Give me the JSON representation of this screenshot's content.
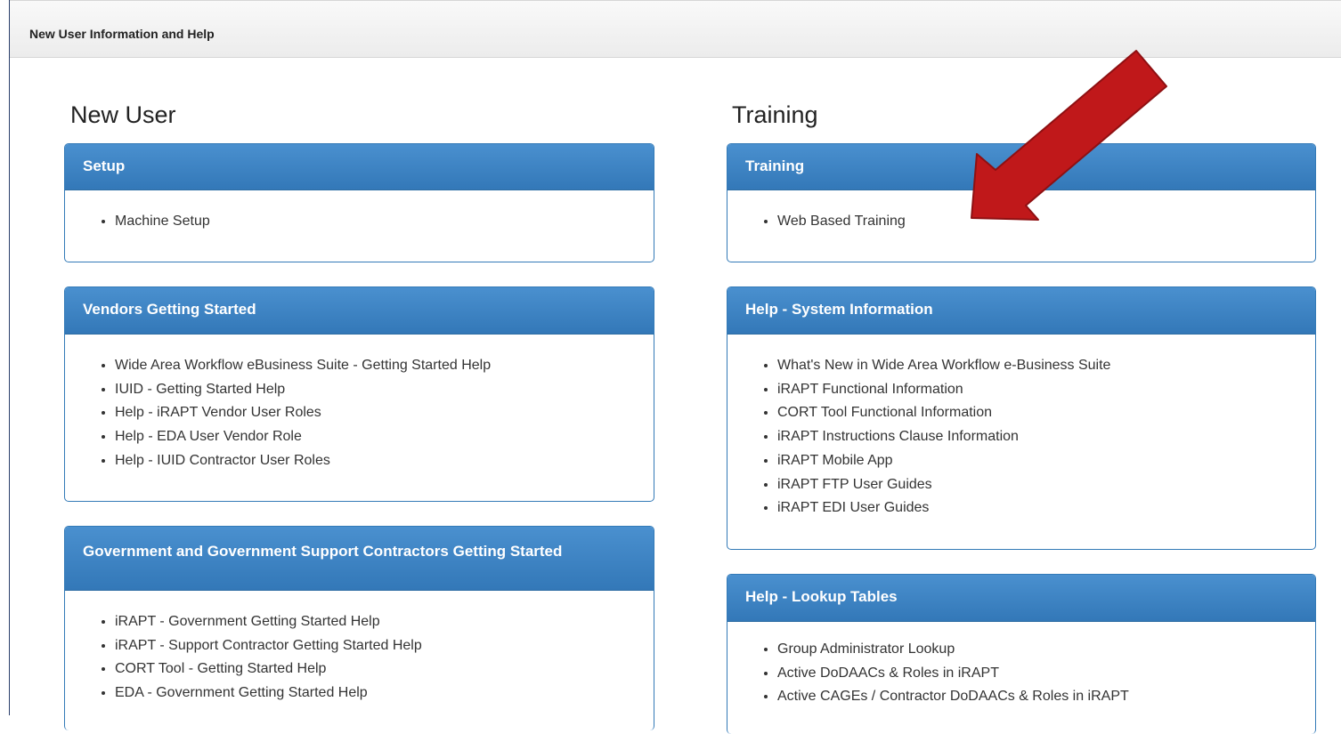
{
  "header": {
    "title": "New User Information and Help"
  },
  "columns": {
    "left_title": "New User",
    "right_title": "Training"
  },
  "panels": {
    "setup": {
      "title": "Setup",
      "items": [
        "Machine Setup"
      ]
    },
    "vendors": {
      "title": "Vendors Getting Started",
      "items": [
        "Wide Area Workflow eBusiness Suite - Getting Started Help",
        "IUID - Getting Started Help",
        "Help - iRAPT Vendor User Roles",
        "Help - EDA User Vendor Role",
        "Help - IUID Contractor User Roles"
      ]
    },
    "government": {
      "title": "Government and Government Support Contractors Getting Started",
      "items": [
        "iRAPT - Government Getting Started Help",
        "iRAPT - Support Contractor Getting Started Help",
        "CORT Tool - Getting Started Help",
        "EDA - Government Getting Started Help"
      ]
    },
    "training": {
      "title": "Training",
      "items": [
        "Web Based Training"
      ]
    },
    "system_info": {
      "title": "Help - System Information",
      "items": [
        "What's New in Wide Area Workflow e-Business Suite",
        "iRAPT Functional Information",
        "CORT Tool Functional Information",
        "iRAPT Instructions Clause Information",
        "iRAPT Mobile App",
        "iRAPT FTP User Guides",
        "iRAPT EDI User Guides"
      ]
    },
    "lookup": {
      "title": "Help - Lookup Tables",
      "items": [
        "Group Administrator Lookup",
        "Active DoDAACs & Roles in iRAPT",
        "Active CAGEs / Contractor DoDAACs & Roles in iRAPT"
      ]
    }
  },
  "colors": {
    "panel_header": "#3a80c0",
    "panel_border": "#337ab7",
    "arrow": "#c0181a"
  }
}
